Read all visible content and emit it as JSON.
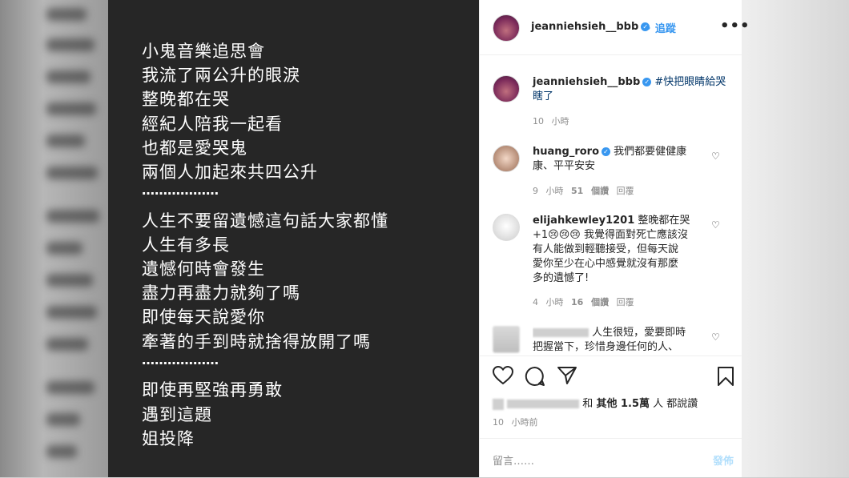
{
  "post_image": {
    "lines": [
      "小鬼音樂追思會",
      "我流了兩公升的眼淚",
      "整晚都在哭",
      "經紀人陪我一起看",
      "也都是愛哭鬼",
      "兩個人加起來共四公升",
      "………………",
      "人生不要留遺憾這句話大家都懂",
      "人生有多長",
      "遺憾何時會發生",
      "盡力再盡力就夠了嗎",
      "即使每天說愛你",
      "牽著的手到時就捨得放開了嗎",
      "………………",
      "即使再堅強再勇敢",
      "遇到這題",
      "姐投降"
    ]
  },
  "header": {
    "username": "jeanniehsieh__bbb",
    "verified_icon": "verified-badge-icon",
    "follow_label": "追蹤",
    "more_label": "•••"
  },
  "caption": {
    "username": "jeanniehsieh__bbb",
    "text_line1": "#快把眼睛給哭",
    "text_line2": "瞎了",
    "time": "10 小時"
  },
  "comments": [
    {
      "username": "huang_roro",
      "text_line1": "我們都要健健康",
      "text_line2": "康、平平安安",
      "time": "9 小時",
      "likes": "51 個讚",
      "reply": "回覆"
    },
    {
      "username": "elijahkewley1201",
      "text_line1": "整晚都在哭",
      "text_line2": "+1😢😢😢 我覺得面對死亡應該沒",
      "text_line3": "有人能做到輕聽接受，但每天說",
      "text_line4": "愛你至少在心中感覺就沒有那麼",
      "text_line5": "多的遺憾了!",
      "time": "4 小時",
      "likes": "16 個讚",
      "reply": "回覆"
    },
    {
      "text_line1": "人生很短，愛要即時",
      "text_line2": "把握當下，珍惜身邊任何的人、"
    }
  ],
  "likes_summary": {
    "and_label": "和",
    "others_label": "其他",
    "count": "1.5萬",
    "suffix": "人 都說讚"
  },
  "post_time": "10 小時前",
  "comment_input": {
    "placeholder": "留言……",
    "post_label": "發佈"
  },
  "colors": {
    "accent": "#3897f0",
    "image_bg": "#262626",
    "text": "#262626",
    "muted": "#8e8e8e"
  }
}
